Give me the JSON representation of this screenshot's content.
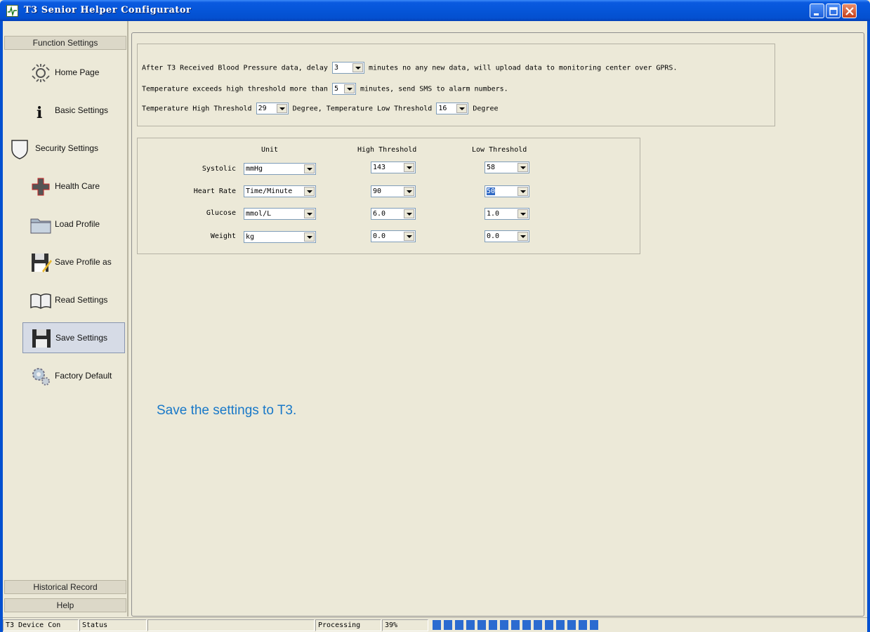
{
  "window": {
    "title": "T3 Senior Helper Configurator"
  },
  "sidebar": {
    "header": "Function Settings",
    "items": [
      {
        "label": "Home Page",
        "icon": "home-icon"
      },
      {
        "label": "Basic  Settings",
        "icon": "info-icon"
      },
      {
        "label": "Security Settings",
        "icon": "shield-icon"
      },
      {
        "label": "Health  Care",
        "icon": "medical-cross-icon"
      },
      {
        "label": "Load  Profile",
        "icon": "folder-icon"
      },
      {
        "label": "Save Profile as",
        "icon": "save-profile-icon"
      },
      {
        "label": "Read Settings",
        "icon": "book-icon"
      },
      {
        "label": "Save Settings",
        "icon": "floppy-icon",
        "selected": true
      },
      {
        "label": "Factory Default",
        "icon": "gears-icon"
      }
    ],
    "footer": [
      "Historical Record",
      "Help"
    ]
  },
  "upload": {
    "line1_pre": "After T3 Received Blood Pressure data, delay",
    "line1_value": "3",
    "line1_post": "minutes no any new data, will upload data to monitoring center over GPRS.",
    "line2_pre": "Temperature exceeds high threshold more than",
    "line2_value": "5",
    "line2_post": "minutes, send SMS to alarm numbers.",
    "line3_pre": "Temperature High Threshold",
    "temp_high": "29",
    "line3_mid": "Degree,   Temperature Low Threshold",
    "temp_low": "16",
    "line3_post": "Degree"
  },
  "thresholds": {
    "headers": {
      "unit": "Unit",
      "high": "High Threshold",
      "low": "Low Threshold"
    },
    "rows": [
      {
        "label": "Systolic",
        "unit": "mmHg",
        "high": "143",
        "low": "58"
      },
      {
        "label": "Heart Rate",
        "unit": "Time/Minute",
        "high": "90",
        "low": "50"
      },
      {
        "label": "Glucose",
        "unit": "mmol/L",
        "high": "6.0",
        "low": "1.0"
      },
      {
        "label": "Weight",
        "unit": "kg",
        "high": "0.0",
        "low": "0.0"
      }
    ]
  },
  "hint": "Save the settings to T3.",
  "statusbar": {
    "device": "T3 Device Con",
    "status": "Status",
    "processing": "Processing",
    "percent": "39%",
    "progress": 0.39
  }
}
